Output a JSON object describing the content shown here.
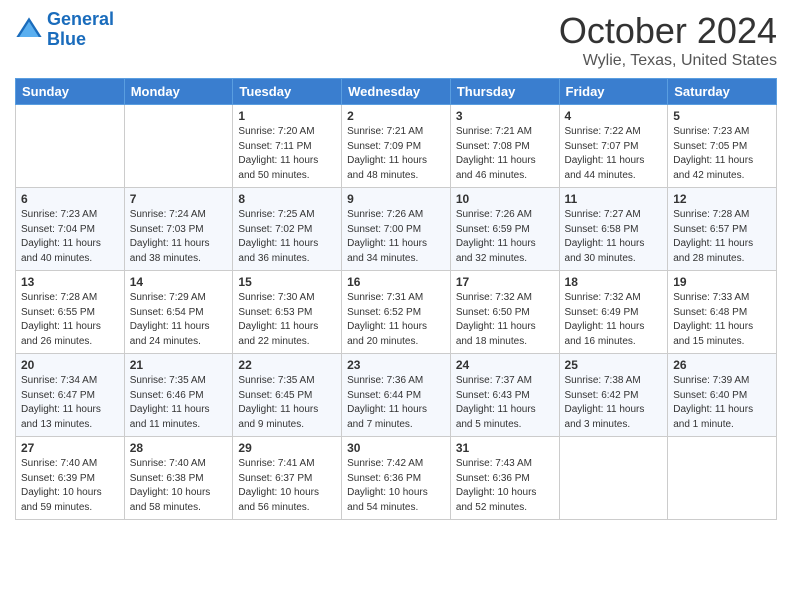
{
  "header": {
    "logo_line1": "General",
    "logo_line2": "Blue",
    "title": "October 2024",
    "location": "Wylie, Texas, United States"
  },
  "days_of_week": [
    "Sunday",
    "Monday",
    "Tuesday",
    "Wednesday",
    "Thursday",
    "Friday",
    "Saturday"
  ],
  "weeks": [
    [
      {
        "day": "",
        "info": ""
      },
      {
        "day": "",
        "info": ""
      },
      {
        "day": "1",
        "info": "Sunrise: 7:20 AM\nSunset: 7:11 PM\nDaylight: 11 hours and 50 minutes."
      },
      {
        "day": "2",
        "info": "Sunrise: 7:21 AM\nSunset: 7:09 PM\nDaylight: 11 hours and 48 minutes."
      },
      {
        "day": "3",
        "info": "Sunrise: 7:21 AM\nSunset: 7:08 PM\nDaylight: 11 hours and 46 minutes."
      },
      {
        "day": "4",
        "info": "Sunrise: 7:22 AM\nSunset: 7:07 PM\nDaylight: 11 hours and 44 minutes."
      },
      {
        "day": "5",
        "info": "Sunrise: 7:23 AM\nSunset: 7:05 PM\nDaylight: 11 hours and 42 minutes."
      }
    ],
    [
      {
        "day": "6",
        "info": "Sunrise: 7:23 AM\nSunset: 7:04 PM\nDaylight: 11 hours and 40 minutes."
      },
      {
        "day": "7",
        "info": "Sunrise: 7:24 AM\nSunset: 7:03 PM\nDaylight: 11 hours and 38 minutes."
      },
      {
        "day": "8",
        "info": "Sunrise: 7:25 AM\nSunset: 7:02 PM\nDaylight: 11 hours and 36 minutes."
      },
      {
        "day": "9",
        "info": "Sunrise: 7:26 AM\nSunset: 7:00 PM\nDaylight: 11 hours and 34 minutes."
      },
      {
        "day": "10",
        "info": "Sunrise: 7:26 AM\nSunset: 6:59 PM\nDaylight: 11 hours and 32 minutes."
      },
      {
        "day": "11",
        "info": "Sunrise: 7:27 AM\nSunset: 6:58 PM\nDaylight: 11 hours and 30 minutes."
      },
      {
        "day": "12",
        "info": "Sunrise: 7:28 AM\nSunset: 6:57 PM\nDaylight: 11 hours and 28 minutes."
      }
    ],
    [
      {
        "day": "13",
        "info": "Sunrise: 7:28 AM\nSunset: 6:55 PM\nDaylight: 11 hours and 26 minutes."
      },
      {
        "day": "14",
        "info": "Sunrise: 7:29 AM\nSunset: 6:54 PM\nDaylight: 11 hours and 24 minutes."
      },
      {
        "day": "15",
        "info": "Sunrise: 7:30 AM\nSunset: 6:53 PM\nDaylight: 11 hours and 22 minutes."
      },
      {
        "day": "16",
        "info": "Sunrise: 7:31 AM\nSunset: 6:52 PM\nDaylight: 11 hours and 20 minutes."
      },
      {
        "day": "17",
        "info": "Sunrise: 7:32 AM\nSunset: 6:50 PM\nDaylight: 11 hours and 18 minutes."
      },
      {
        "day": "18",
        "info": "Sunrise: 7:32 AM\nSunset: 6:49 PM\nDaylight: 11 hours and 16 minutes."
      },
      {
        "day": "19",
        "info": "Sunrise: 7:33 AM\nSunset: 6:48 PM\nDaylight: 11 hours and 15 minutes."
      }
    ],
    [
      {
        "day": "20",
        "info": "Sunrise: 7:34 AM\nSunset: 6:47 PM\nDaylight: 11 hours and 13 minutes."
      },
      {
        "day": "21",
        "info": "Sunrise: 7:35 AM\nSunset: 6:46 PM\nDaylight: 11 hours and 11 minutes."
      },
      {
        "day": "22",
        "info": "Sunrise: 7:35 AM\nSunset: 6:45 PM\nDaylight: 11 hours and 9 minutes."
      },
      {
        "day": "23",
        "info": "Sunrise: 7:36 AM\nSunset: 6:44 PM\nDaylight: 11 hours and 7 minutes."
      },
      {
        "day": "24",
        "info": "Sunrise: 7:37 AM\nSunset: 6:43 PM\nDaylight: 11 hours and 5 minutes."
      },
      {
        "day": "25",
        "info": "Sunrise: 7:38 AM\nSunset: 6:42 PM\nDaylight: 11 hours and 3 minutes."
      },
      {
        "day": "26",
        "info": "Sunrise: 7:39 AM\nSunset: 6:40 PM\nDaylight: 11 hours and 1 minute."
      }
    ],
    [
      {
        "day": "27",
        "info": "Sunrise: 7:40 AM\nSunset: 6:39 PM\nDaylight: 10 hours and 59 minutes."
      },
      {
        "day": "28",
        "info": "Sunrise: 7:40 AM\nSunset: 6:38 PM\nDaylight: 10 hours and 58 minutes."
      },
      {
        "day": "29",
        "info": "Sunrise: 7:41 AM\nSunset: 6:37 PM\nDaylight: 10 hours and 56 minutes."
      },
      {
        "day": "30",
        "info": "Sunrise: 7:42 AM\nSunset: 6:36 PM\nDaylight: 10 hours and 54 minutes."
      },
      {
        "day": "31",
        "info": "Sunrise: 7:43 AM\nSunset: 6:36 PM\nDaylight: 10 hours and 52 minutes."
      },
      {
        "day": "",
        "info": ""
      },
      {
        "day": "",
        "info": ""
      }
    ]
  ]
}
